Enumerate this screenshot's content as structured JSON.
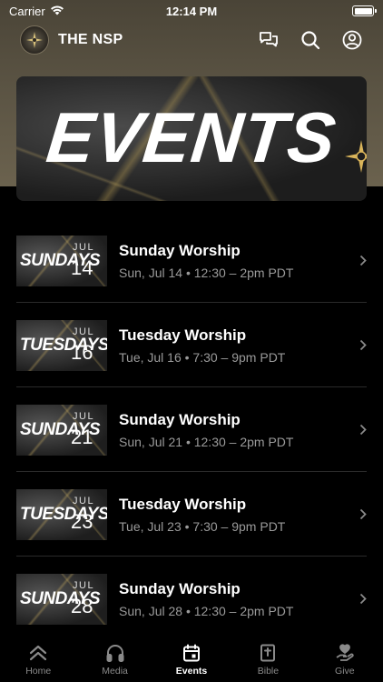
{
  "status_bar": {
    "carrier": "Carrier",
    "time": "12:14 PM"
  },
  "app": {
    "title": "THE NSP"
  },
  "banner": {
    "text": "EVENTS"
  },
  "events": [
    {
      "thumb_word": "SUNDAYS",
      "thumb_month": "JUL",
      "thumb_day": "14",
      "title": "Sunday Worship",
      "subtitle": "Sun, Jul 14 • 12:30 – 2pm PDT"
    },
    {
      "thumb_word": "TUESDAYS",
      "thumb_month": "JUL",
      "thumb_day": "16",
      "title": "Tuesday Worship",
      "subtitle": "Tue, Jul 16 • 7:30 – 9pm PDT"
    },
    {
      "thumb_word": "SUNDAYS",
      "thumb_month": "JUL",
      "thumb_day": "21",
      "title": "Sunday Worship",
      "subtitle": "Sun, Jul 21 • 12:30 – 2pm PDT"
    },
    {
      "thumb_word": "TUESDAYS",
      "thumb_month": "JUL",
      "thumb_day": "23",
      "title": "Tuesday Worship",
      "subtitle": "Tue, Jul 23 • 7:30 – 9pm PDT"
    },
    {
      "thumb_word": "SUNDAYS",
      "thumb_month": "JUL",
      "thumb_day": "28",
      "title": "Sunday Worship",
      "subtitle": "Sun, Jul 28 • 12:30 – 2pm PDT"
    }
  ],
  "tabs": [
    {
      "label": "Home",
      "icon": "home-chevrons-icon"
    },
    {
      "label": "Media",
      "icon": "headphones-icon"
    },
    {
      "label": "Events",
      "icon": "calendar-icon"
    },
    {
      "label": "Bible",
      "icon": "bible-icon"
    },
    {
      "label": "Give",
      "icon": "give-hand-heart-icon"
    }
  ],
  "colors": {
    "header_bg": "#5a5343",
    "accent": "#c8aa5a",
    "muted_text": "#9a9a9a",
    "inactive_tab": "#8a8a8a"
  }
}
